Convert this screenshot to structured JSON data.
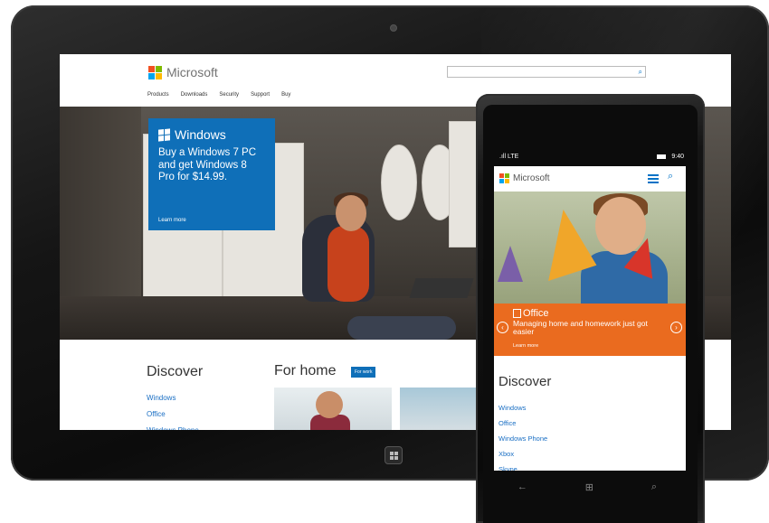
{
  "tablet": {
    "site": {
      "brand": "Microsoft",
      "nav": [
        "Products",
        "Downloads",
        "Security",
        "Support",
        "Buy"
      ],
      "search": {
        "placeholder": "",
        "icon": "search-icon"
      },
      "promo": {
        "title": "Windows",
        "body": "Buy a Windows 7 PC and get Windows 8 Pro for $14.99.",
        "link": "Learn more"
      },
      "discover": {
        "title": "Discover",
        "links": [
          "Windows",
          "Office",
          "Windows Phone"
        ]
      },
      "for_home": {
        "title": "For home",
        "tab": "For work"
      }
    }
  },
  "phone": {
    "status": {
      "signal": ".ıll",
      "network": "LTE",
      "time": "9:40"
    },
    "site": {
      "brand": "Microsoft",
      "hero": {
        "product": "Office",
        "body": "Managing home and homework just got easier",
        "link": "Learn more"
      },
      "discover": {
        "title": "Discover",
        "links": [
          "Windows",
          "Office",
          "Windows Phone",
          "Xbox",
          "Skype"
        ]
      }
    },
    "nav": {
      "back": "←",
      "start": "⊞",
      "search": "⌕"
    }
  },
  "colors": {
    "accent_blue": "#0f6fb8",
    "office_orange": "#ea6b1f",
    "link_blue": "#1a6fc4"
  }
}
